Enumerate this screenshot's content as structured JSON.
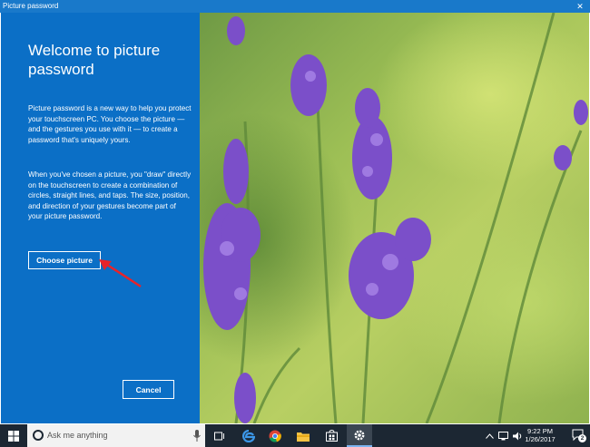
{
  "window": {
    "title": "Picture password",
    "close_glyph": "✕"
  },
  "panel": {
    "heading": "Welcome to picture password",
    "paragraph1": "Picture password is a new way to help you protect your touchscreen PC. You choose the picture — and the gestures you use with it — to create a password that's uniquely yours.",
    "paragraph2": "When you've chosen a picture, you \"draw\" directly on the touchscreen to create a combination of circles, straight lines, and taps. The size, position, and direction of your gestures become part of your picture password.",
    "choose_button": "Choose picture",
    "cancel_button": "Cancel"
  },
  "picture": {
    "subject": "lavender-flowers",
    "flower_color": "#7b4fc9",
    "annotation_arrow_color": "#e8232a"
  },
  "taskbar": {
    "search_placeholder": "Ask me anything",
    "apps": [
      "task-view-icon",
      "edge-icon",
      "chrome-icon",
      "file-explorer-icon",
      "store-icon",
      "settings-icon"
    ],
    "time": "9:22 PM",
    "date": "1/26/2017",
    "notification_count": "2",
    "background": "#1c2733"
  }
}
